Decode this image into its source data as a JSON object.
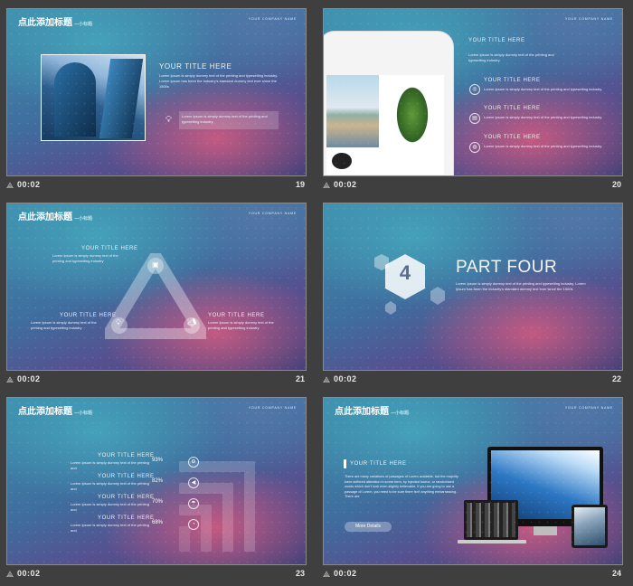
{
  "footer_time": "00:02",
  "slides": [
    {
      "number": "19",
      "header": "点此添加标题",
      "header_sub": "—小标题",
      "company": "YOUR COMPANY NAME",
      "title": "YOUR TITLE HERE",
      "body": "Lorem Ipsum is simply dummy text of the printing and typesetting industry. Lorem Ipsum has been the industry's standard dummy text ever since the 1500s",
      "caption": "Lorem Ipsum is simply dummy text of the printing and typesetting industry."
    },
    {
      "number": "20",
      "company": "YOUR COMPANY NAME",
      "title": "YOUR TITLE HERE",
      "body": "Lorem Ipsum is simply dummy text of the printing and typesetting industry.",
      "items": [
        {
          "title": "YOUR TITLE HERE",
          "body": "Lorem Ipsum is simply dummy text of the printing and typesetting industry."
        },
        {
          "title": "YOUR TITLE HERE",
          "body": "Lorem Ipsum is simply dummy text of the printing and typesetting industry."
        },
        {
          "title": "YOUR TITLE HERE",
          "body": "Lorem Ipsum is simply dummy text of the printing and typesetting industry."
        }
      ]
    },
    {
      "number": "21",
      "header": "点此添加标题",
      "header_sub": "—小标题",
      "company": "YOUR COMPANY NAME",
      "top": {
        "title": "YOUR TITLE HERE",
        "body": "Lorem Ipsum is simply dummy text of the printing and typesetting industry"
      },
      "left": {
        "title": "YOUR TITLE HERE",
        "body": "Lorem Ipsum is simply dummy text of the printing and typesetting industry"
      },
      "right": {
        "title": "YOUR TITLE HERE",
        "body": "Lorem Ipsum is simply dummy text of the printing and typesetting industry"
      }
    },
    {
      "number": "22",
      "part_number": "4",
      "part_title": "PART FOUR",
      "body": "Lorem Ipsum is simply dummy text of the printing and typesetting industry. Lorem Ipsum has been the industry's standard dummy text ever since the 1500s"
    },
    {
      "number": "23",
      "header": "点此添加标题",
      "header_sub": "—小标题",
      "company": "YOUR COMPANY NAME",
      "rows": [
        {
          "title": "YOUR TITLE HERE",
          "body": "Lorem Ipsum is simply dummy text of the printing and",
          "percent": "93%",
          "icon": "gear-icon"
        },
        {
          "title": "YOUR TITLE HERE",
          "body": "Lorem Ipsum is simply dummy text of the printing and",
          "percent": "82%",
          "icon": "megaphone-icon"
        },
        {
          "title": "YOUR TITLE HERE",
          "body": "Lorem Ipsum is simply dummy text of the printing and",
          "percent": "70%",
          "icon": "umbrella-icon"
        },
        {
          "title": "YOUR TITLE HERE",
          "body": "Lorem Ipsum is simply dummy text of the printing and",
          "percent": "68%",
          "icon": "clock-icon"
        }
      ]
    },
    {
      "number": "24",
      "header": "点此添加标题",
      "header_sub": "—小标题",
      "company": "YOUR COMPANY NAME",
      "title": "YOUR TITLE HERE",
      "body": "There are many variations of passages of Lorem available, but the majority have suffered alteration in some form, by injected humor, or randomized words which don't look even slightly believable. If you are going to use a passage of Lorem, you need to be sure there isn't anything embarrassing. There are",
      "button": "More Details"
    }
  ]
}
